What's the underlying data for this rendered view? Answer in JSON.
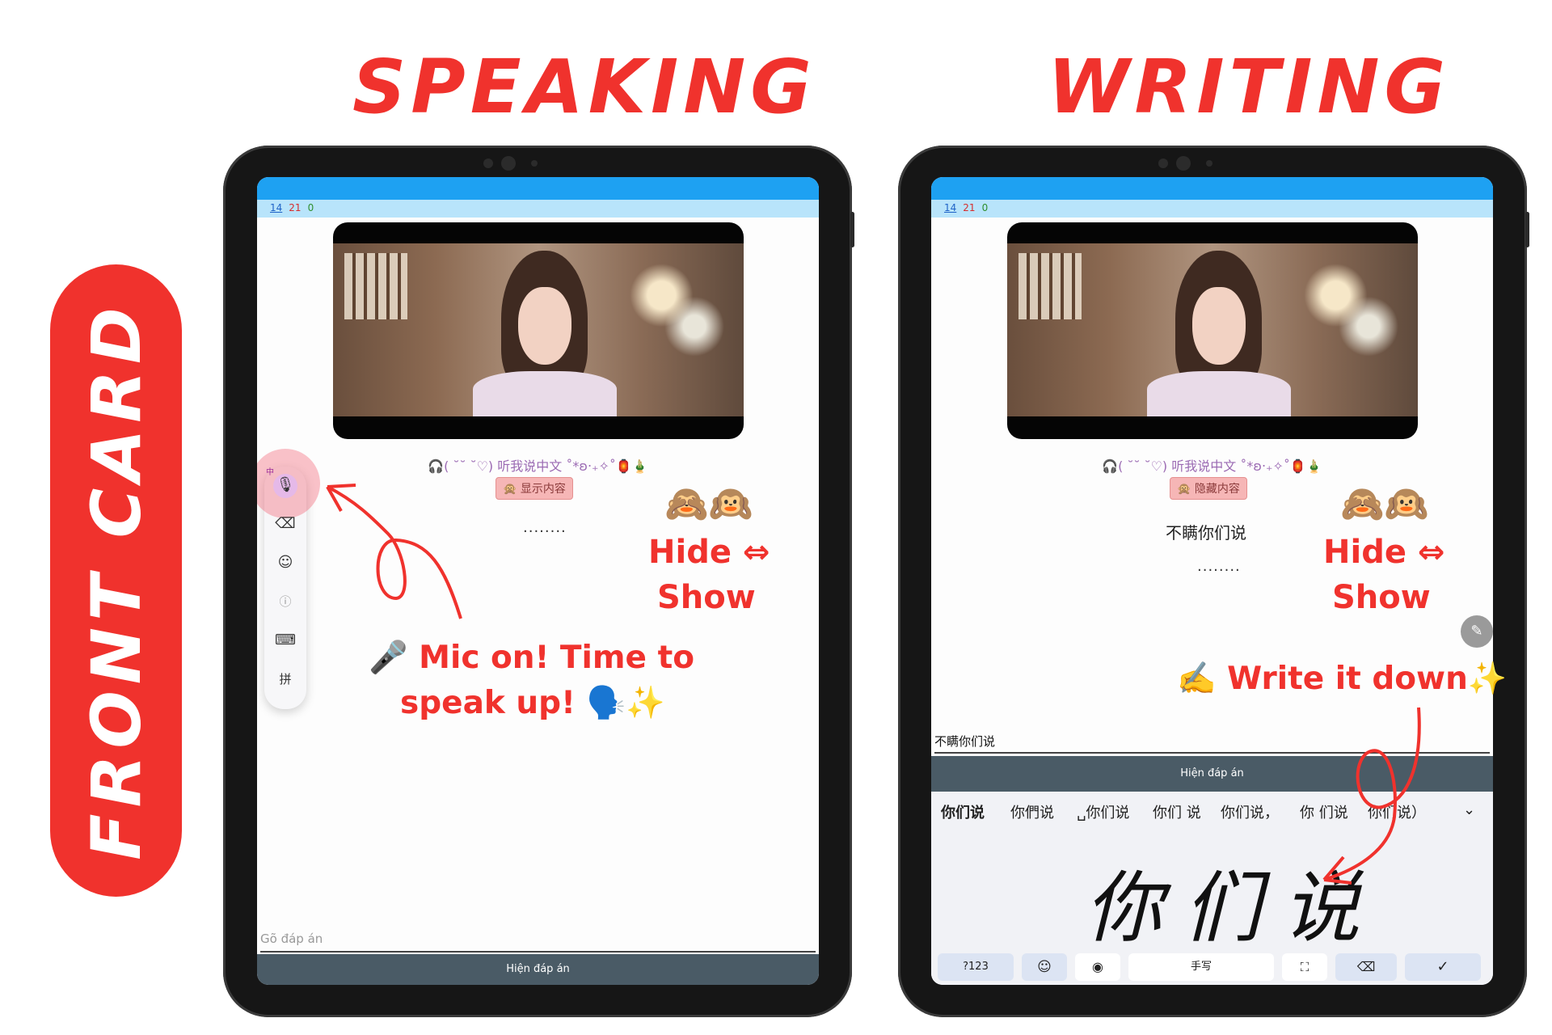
{
  "titles": {
    "speaking": "SPEAKING",
    "writing": "WRITING",
    "front_card": "FRONT CARD"
  },
  "status_counts": {
    "blue": "14",
    "red": "21",
    "green": "0"
  },
  "subtitle_line": "🎧( ˘˘ ˘♡) 听我说中文 ˚*ʚ‧₊✧˚🏮🎍",
  "speaking": {
    "toggle_button": "🙊 显示内容",
    "dots": "........",
    "hide_show_emoji": "🙈🙉",
    "hide_show_line1": "Hide ⇔",
    "hide_show_line2": "Show",
    "mic_note_line1": "🎤 Mic on! Time to",
    "mic_note_line2": "speak up! 🗣️✨",
    "toolbar_lang": "中",
    "toolbar_pinyin": "拼",
    "answer_placeholder": "Gõ đáp án",
    "reveal_button": "Hiện đáp án"
  },
  "writing": {
    "toggle_button": "🙊 隐藏内容",
    "revealed_text": "不瞒你们说",
    "dots": "........",
    "hide_show_emoji": "🙈🙉",
    "hide_show_line1": "Hide ⇔",
    "hide_show_line2": "Show",
    "write_note": "✍️ Write it down✨",
    "answer_value": "不瞒你们说",
    "reveal_button": "Hiện đáp án",
    "candidates": [
      "你们说",
      "你們说",
      "␣你们说",
      "你们 说",
      "你们说，",
      "你 们说",
      "你们说）"
    ],
    "handwriting": "你们说",
    "keys": {
      "symbols": "?123",
      "space": "手写"
    }
  }
}
